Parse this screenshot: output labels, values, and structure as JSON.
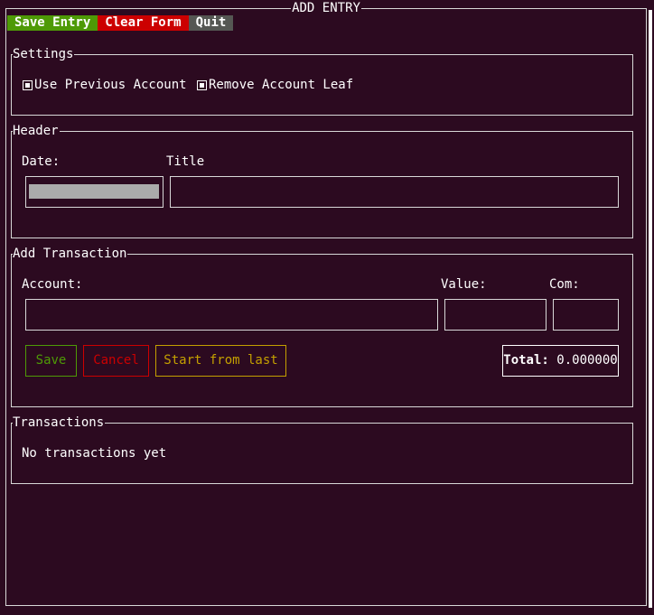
{
  "window": {
    "title": "ADD ENTRY"
  },
  "menu": {
    "items": [
      {
        "label": "Save Entry",
        "color": "#4e9a06"
      },
      {
        "label": "Clear Form",
        "color": "#cc0000"
      },
      {
        "label": "Quit",
        "color": "#555753"
      }
    ]
  },
  "settings": {
    "title": "Settings",
    "options": [
      {
        "label": "Use Previous Account",
        "checked": true
      },
      {
        "label": "Remove Account Leaf",
        "checked": true
      }
    ]
  },
  "header": {
    "title": "Header",
    "date_label": "Date:",
    "title_label": "Title",
    "date_value": "",
    "title_value": ""
  },
  "add_transaction": {
    "title": "Add Transaction",
    "account_label": "Account:",
    "value_label": "Value:",
    "com_label": "Com:",
    "account_value": "",
    "value_value": "",
    "com_value": "",
    "save_label": "Save",
    "cancel_label": "Cancel",
    "start_from_last_label": "Start from last",
    "total_label": "Total:",
    "total_value": "0.000000",
    "colors": {
      "save": "#4e9a06",
      "cancel": "#cc0000",
      "start_from_last": "#c4a000"
    }
  },
  "transactions": {
    "title": "Transactions",
    "empty_text": "No transactions yet"
  }
}
